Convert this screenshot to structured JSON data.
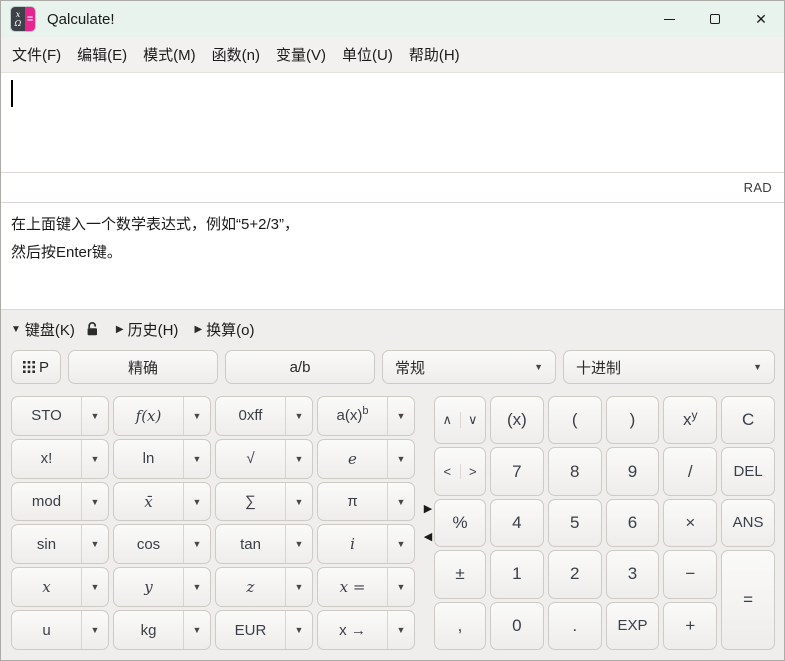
{
  "titlebar": {
    "title": "Qalculate!",
    "icon": {
      "top": "x",
      "bottom": "Ω",
      "equals": "="
    }
  },
  "icons": {
    "close": "✕",
    "dropdown": "▼",
    "tab_expanded": "▼",
    "tab_collapsed": "▶",
    "expander_right": "▶",
    "expander_left": "◀"
  },
  "menu": {
    "items": [
      "文件(F)",
      "编辑(E)",
      "模式(M)",
      "函数(n)",
      "变量(V)",
      "单位(U)",
      "帮助(H)"
    ]
  },
  "expression": {
    "value": ""
  },
  "status": {
    "angle_mode": "RAD"
  },
  "help": {
    "line1": "在上面键入一个数学表达式，例如“5+2/3”，",
    "line2": "然后按Enter键。"
  },
  "tabs": {
    "keyboard": "键盘(K)",
    "history": "历史(H)",
    "convert": "换算(o)"
  },
  "toolbar": {
    "keypad": "P",
    "exact": "精确",
    "fraction": "a/b",
    "number_format": "常规",
    "number_base": "十进制"
  },
  "keypad_left": {
    "buttons": [
      {
        "label": "STO"
      },
      {
        "label": "f(x)"
      },
      {
        "label": "0xff"
      },
      {
        "label": "a(x)",
        "sup": "b"
      },
      {
        "label": "x!"
      },
      {
        "label": "ln"
      },
      {
        "label": "√"
      },
      {
        "label": "e"
      },
      {
        "label": "mod"
      },
      {
        "label": "x̄"
      },
      {
        "label": "∑"
      },
      {
        "label": "π"
      },
      {
        "label": "sin"
      },
      {
        "label": "cos"
      },
      {
        "label": "tan"
      },
      {
        "label": "i"
      },
      {
        "label": "x"
      },
      {
        "label": "y"
      },
      {
        "label": "z"
      },
      {
        "label": "x ="
      },
      {
        "label": "u"
      },
      {
        "label": "kg"
      },
      {
        "label": "EUR"
      },
      {
        "label": "x →"
      }
    ]
  },
  "keypad_right": {
    "nav": {
      "up": "∧",
      "down": "∨",
      "left": "<",
      "right": ">"
    },
    "keys": [
      {
        "label": "(x)"
      },
      {
        "label": "("
      },
      {
        "label": ")"
      },
      {
        "label": "x",
        "sup": "y"
      },
      {
        "label": "C"
      },
      {
        "label": "7"
      },
      {
        "label": "8"
      },
      {
        "label": "9"
      },
      {
        "label": "/"
      },
      {
        "label": "DEL"
      },
      {
        "label": "%"
      },
      {
        "label": "4"
      },
      {
        "label": "5"
      },
      {
        "label": "6"
      },
      {
        "label": "×"
      },
      {
        "label": "ANS"
      },
      {
        "label": "±"
      },
      {
        "label": "1"
      },
      {
        "label": "2"
      },
      {
        "label": "3"
      },
      {
        "label": "−"
      },
      {
        "label": "="
      },
      {
        "label": ","
      },
      {
        "label": "0"
      },
      {
        "label": "."
      },
      {
        "label": "EXP"
      },
      {
        "label": "+"
      }
    ]
  }
}
